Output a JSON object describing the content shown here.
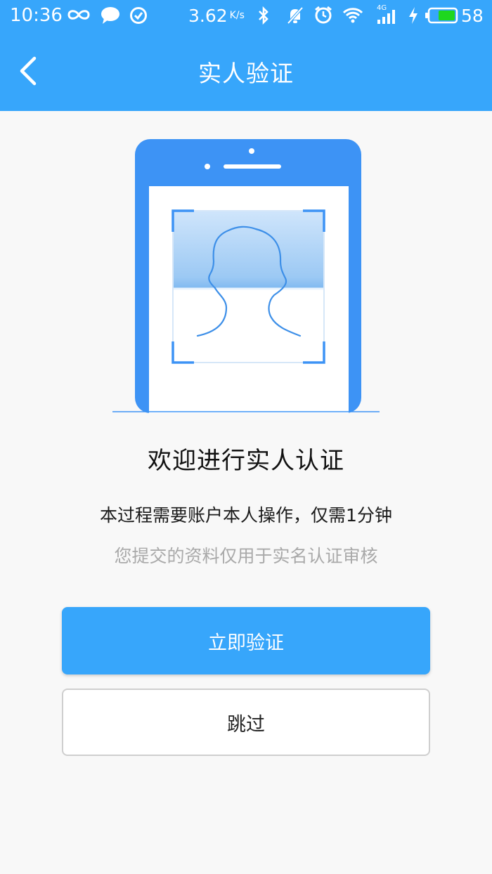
{
  "status_bar": {
    "time": "10:36",
    "network_speed": "3.62",
    "network_speed_unit": "K/s",
    "network_type": "4G",
    "battery_percent": "58",
    "icons": [
      "infinity-icon",
      "chat-bubble-icon",
      "check-circle-icon",
      "bluetooth-icon",
      "muted-bell-icon",
      "alarm-clock-icon",
      "wifi-icon",
      "signal-icon",
      "charging-bolt-icon",
      "battery-icon"
    ]
  },
  "header": {
    "title": "实人验证",
    "back_icon": "chevron-left-icon"
  },
  "hero": {
    "icon": "face-scan-phone-illustration"
  },
  "content": {
    "welcome": "欢迎进行实人认证",
    "description": "本过程需要账户本人操作，仅需1分钟",
    "note": "您提交的资料仅用于实名认证审核"
  },
  "actions": {
    "verify_label": "立即验证",
    "skip_label": "跳过"
  },
  "colors": {
    "primary": "#37a6fb",
    "phone_blue": "#3d93f5",
    "background": "#f8f8f8",
    "note_text": "#a9a9a9"
  }
}
